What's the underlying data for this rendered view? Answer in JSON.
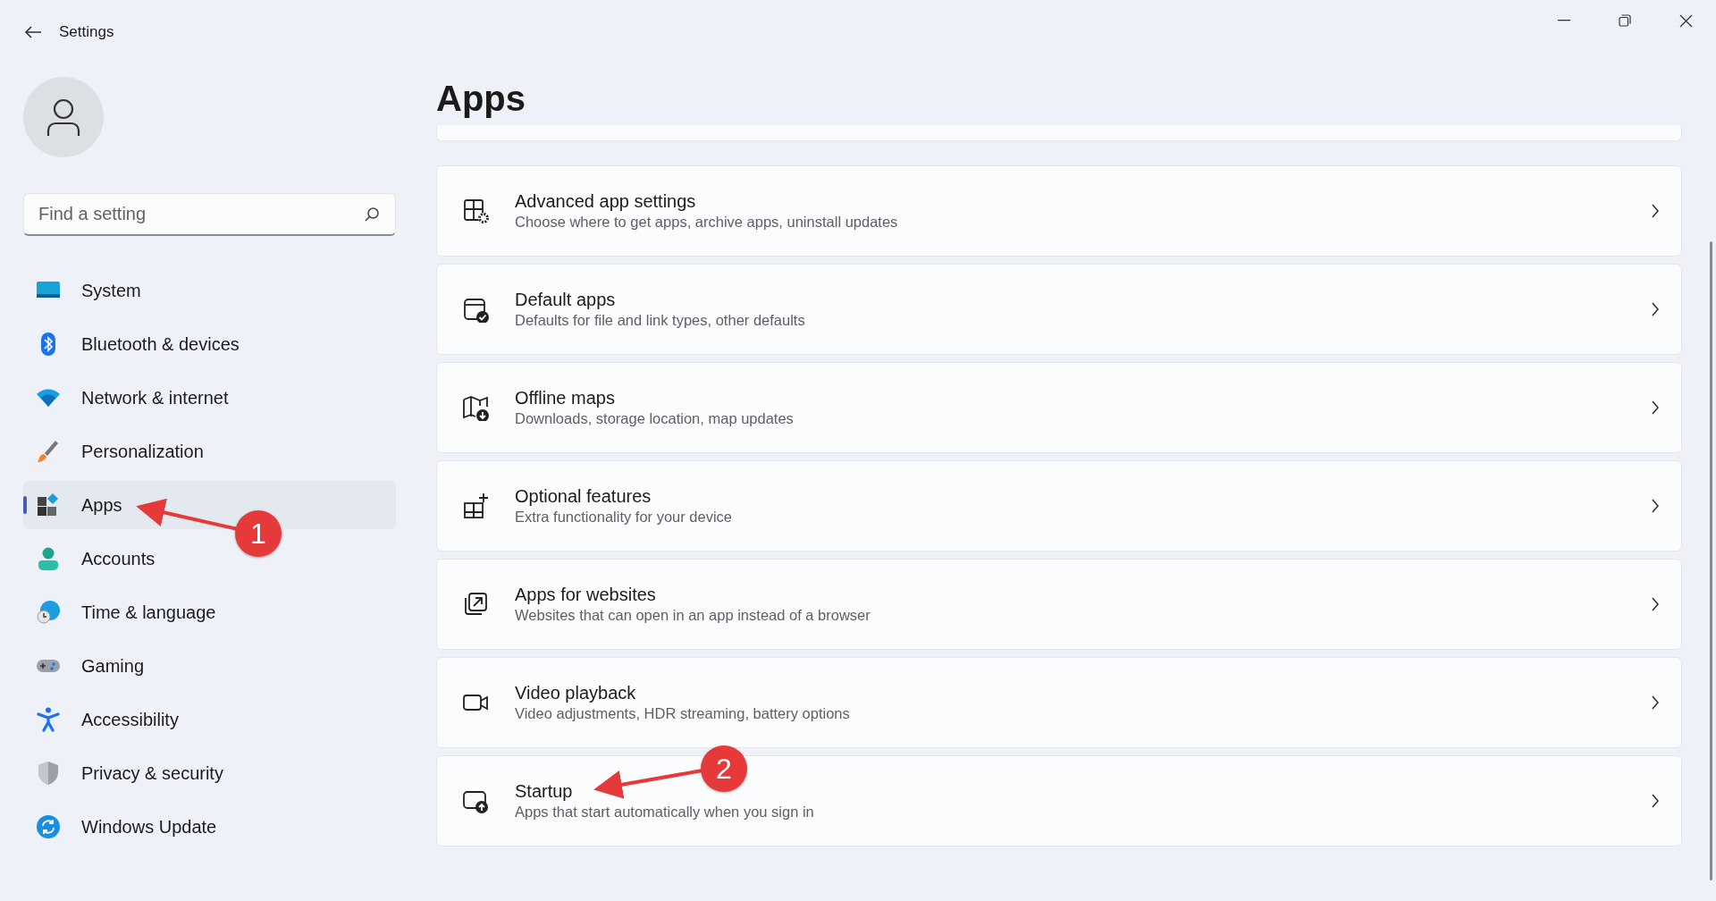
{
  "window": {
    "title": "Settings"
  },
  "search": {
    "placeholder": "Find a setting"
  },
  "sidebar": {
    "items": [
      {
        "label": "System",
        "selected": false
      },
      {
        "label": "Bluetooth & devices",
        "selected": false
      },
      {
        "label": "Network & internet",
        "selected": false
      },
      {
        "label": "Personalization",
        "selected": false
      },
      {
        "label": "Apps",
        "selected": true
      },
      {
        "label": "Accounts",
        "selected": false
      },
      {
        "label": "Time & language",
        "selected": false
      },
      {
        "label": "Gaming",
        "selected": false
      },
      {
        "label": "Accessibility",
        "selected": false
      },
      {
        "label": "Privacy & security",
        "selected": false
      },
      {
        "label": "Windows Update",
        "selected": false
      }
    ]
  },
  "page": {
    "title": "Apps",
    "settings": [
      {
        "title": "Advanced app settings",
        "description": "Choose where to get apps, archive apps, uninstall updates"
      },
      {
        "title": "Default apps",
        "description": "Defaults for file and link types, other defaults"
      },
      {
        "title": "Offline maps",
        "description": "Downloads, storage location, map updates"
      },
      {
        "title": "Optional features",
        "description": "Extra functionality for your device"
      },
      {
        "title": "Apps for websites",
        "description": "Websites that can open in an app instead of a browser"
      },
      {
        "title": "Video playback",
        "description": "Video adjustments, HDR streaming, battery options"
      },
      {
        "title": "Startup",
        "description": "Apps that start automatically when you sign in"
      }
    ]
  },
  "annotations": [
    {
      "label": "1"
    },
    {
      "label": "2"
    }
  ]
}
